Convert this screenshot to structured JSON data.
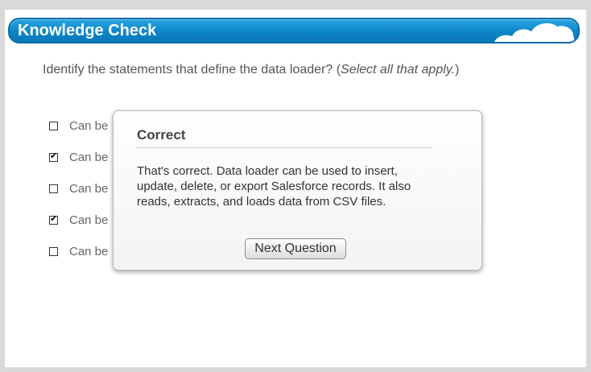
{
  "header": {
    "title": "Knowledge Check"
  },
  "question": {
    "text": "Identify the statements that define the data loader? (",
    "instruction": "Select all that apply.",
    "suffix": ")"
  },
  "options": [
    {
      "label": "Can be",
      "checked": false
    },
    {
      "label": "Can be",
      "checked": true
    },
    {
      "label": "Can be",
      "checked": false
    },
    {
      "label": "Can be",
      "checked": true
    },
    {
      "label": "Can be",
      "checked": false
    }
  ],
  "feedback": {
    "title": "Correct",
    "body": "That's correct. Data loader can be used to insert, update, delete, or export Salesforce records. It also reads, extracts, and loads data from CSV files.",
    "button_label": "Next Question"
  },
  "colors": {
    "header_blue": "#0c85c9",
    "background": "#d9d9d9"
  }
}
